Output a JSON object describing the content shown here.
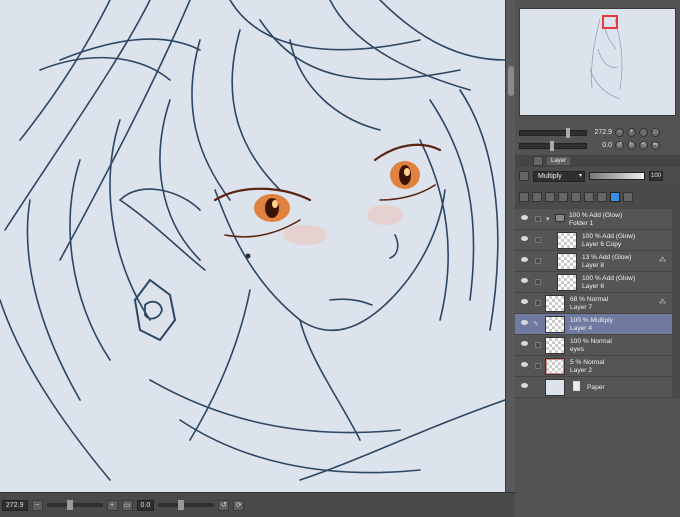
{
  "statusbar": {
    "zoom": "272.9",
    "angle": "0.0"
  },
  "navigator": {
    "zoom_value": "272.9",
    "angle_value": "0.0"
  },
  "layer_panel": {
    "tab_label": "Layer",
    "blend_mode": "Multiply",
    "opacity": "100",
    "layers": [
      {
        "line1": "100 % Add (Glow)",
        "line2": "Folder 1",
        "type": "folder"
      },
      {
        "line1": "100 % Add (Glow)",
        "line2": "Layer 6 Copy",
        "type": "raster"
      },
      {
        "line1": "13 % Add (Glow)",
        "line2": "Layer 8",
        "type": "raster"
      },
      {
        "line1": "100 % Add (Glow)",
        "line2": "Layer 6",
        "type": "raster"
      },
      {
        "line1": "68 % Normal",
        "line2": "Layer 7",
        "type": "raster"
      },
      {
        "line1": "100 % Multiply",
        "line2": "Layer 4",
        "type": "raster"
      },
      {
        "line1": "100 % Normal",
        "line2": "eyes",
        "type": "raster"
      },
      {
        "line1": "5 % Normal",
        "line2": "Layer 2",
        "type": "raster"
      },
      {
        "line1": "Paper",
        "line2": "",
        "type": "paper"
      }
    ]
  }
}
